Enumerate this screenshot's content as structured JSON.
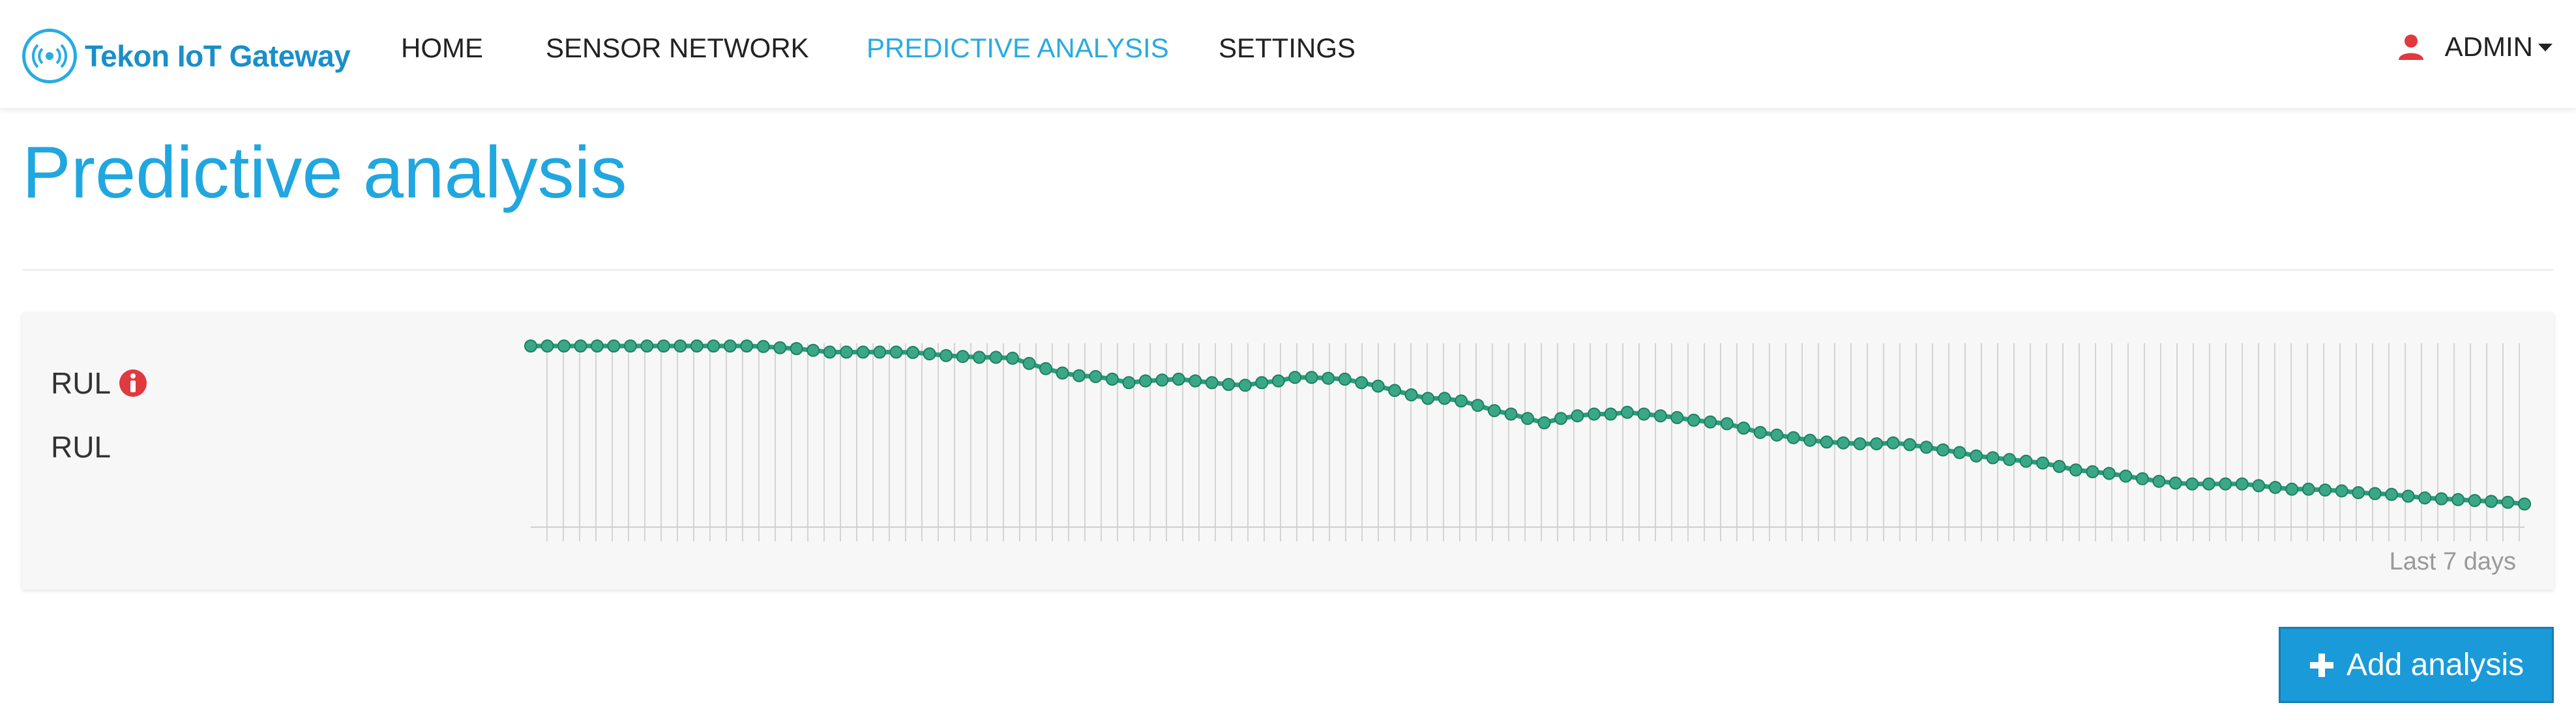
{
  "brand": {
    "name": "Tekon IoT Gateway",
    "logo_icon": "wireless-signal-icon",
    "color": "#1a8fc9"
  },
  "nav": {
    "items": [
      {
        "label": "HOME",
        "active": false
      },
      {
        "label": "SENSOR NETWORK",
        "active": false
      },
      {
        "label": "PREDICTIVE ANALYSIS",
        "active": true
      },
      {
        "label": "SETTINGS",
        "active": false
      }
    ],
    "user": {
      "label": "ADMIN",
      "icon": "user-icon",
      "icon_color": "#e0393e",
      "caret": "chevron-down-icon"
    },
    "active_color": "#29abe2"
  },
  "page": {
    "title": "Predictive analysis"
  },
  "analysis_card": {
    "label": "RUL",
    "status_icon": "info-icon",
    "status_color": "#e0393e",
    "value_label": "RUL",
    "period": "Last 7 days"
  },
  "chart_data": {
    "type": "line",
    "title": "",
    "xlabel": "",
    "ylabel": "",
    "series": [
      {
        "color": "#2a9d77",
        "values": [
          1.0,
          1.0,
          1.0,
          1.0,
          1.0,
          1.0,
          1.0,
          1.0,
          1.0,
          1.0,
          1.0,
          1.0,
          1.0,
          1.0,
          0.997,
          0.99,
          0.985,
          0.975,
          0.965,
          0.965,
          0.965,
          0.965,
          0.965,
          0.963,
          0.955,
          0.945,
          0.94,
          0.935,
          0.935,
          0.93,
          0.9,
          0.87,
          0.845,
          0.83,
          0.825,
          0.81,
          0.79,
          0.8,
          0.805,
          0.81,
          0.8,
          0.79,
          0.78,
          0.775,
          0.79,
          0.8,
          0.82,
          0.82,
          0.815,
          0.81,
          0.79,
          0.77,
          0.745,
          0.72,
          0.7,
          0.7,
          0.685,
          0.66,
          0.63,
          0.61,
          0.585,
          0.56,
          0.585,
          0.6,
          0.61,
          0.61,
          0.62,
          0.61,
          0.6,
          0.59,
          0.575,
          0.565,
          0.555,
          0.53,
          0.505,
          0.49,
          0.475,
          0.46,
          0.45,
          0.445,
          0.44,
          0.44,
          0.445,
          0.435,
          0.42,
          0.405,
          0.39,
          0.37,
          0.36,
          0.35,
          0.34,
          0.33,
          0.31,
          0.29,
          0.28,
          0.27,
          0.255,
          0.24,
          0.225,
          0.215,
          0.21,
          0.21,
          0.21,
          0.21,
          0.2,
          0.19,
          0.18,
          0.18,
          0.175,
          0.17,
          0.16,
          0.155,
          0.15,
          0.14,
          0.13,
          0.125,
          0.12,
          0.115,
          0.11,
          0.105,
          0.095
        ]
      }
    ],
    "ylim": [
      0,
      1
    ],
    "grid": true,
    "legend": "none"
  },
  "actions": {
    "add_label": "Add analysis",
    "add_icon": "plus-icon",
    "button_color": "#1a9ad8"
  }
}
